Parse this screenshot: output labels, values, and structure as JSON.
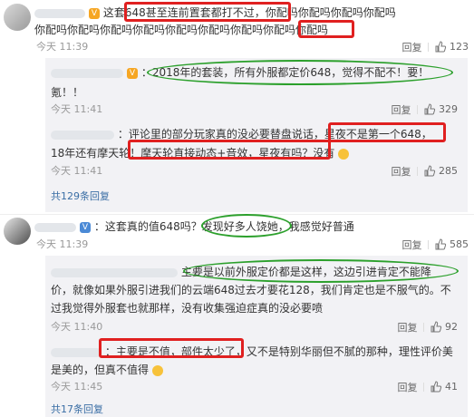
{
  "comments": [
    {
      "text1": "这套648甚至连前置套都打不过，你配吗你配吗你配吗你配吗",
      "text2": "你配吗你配吗你配吗你配吗你配吗你配吗你配吗你配吗你配吗",
      "time": "今天 11:39",
      "reply_label": "回复",
      "likes": "123",
      "replies": [
        {
          "text1": "：2018年的套装，所有外服都定价648，觉得不配不！要！",
          "text2": "氪！！",
          "time": "今天 11:41",
          "reply_label": "回复",
          "likes": "329"
        },
        {
          "text1": "：评论里的部分玩家真的没必要替盘说话，星夜不是第一个648，",
          "text2": "18年还有摩天轮！摩天轮直接动态+音效，星夜有吗？没有",
          "time": "今天 11:41",
          "reply_label": "回复",
          "likes": "285"
        }
      ],
      "more": "共129条回复"
    },
    {
      "text1": "：这套真的值648吗？发现好多人饶她，我感觉好普通",
      "time": "今天 11:39",
      "reply_label": "回复",
      "likes": "585",
      "replies": [
        {
          "text1": "主要是以前外服定价都是这样，这边引进肯定不能降",
          "text2": "价，就像如果外服引进我们的云端648过去才要花128，我们肯定也是不服气的。不",
          "text3": "过我觉得外服套也就那样，没有收集强迫症真的没必要喷",
          "time": "今天 11:40",
          "reply_label": "回复",
          "likes": "92"
        },
        {
          "text1": "：主要是不值，部件太少了，又不是特别华丽但不腻的那种，理性评价美",
          "text2": "是美的，但真不值得",
          "time": "今天 11:45",
          "reply_label": "回复",
          "likes": "41"
        }
      ],
      "more": "共17条回复"
    }
  ],
  "colors": {
    "highlight_red": "#e02020",
    "highlight_green": "#2ca02c",
    "link": "#3a6ea5"
  },
  "icons": {
    "like": "thumbs-up-icon",
    "reply_emoji": "smile-emoji-icon"
  }
}
